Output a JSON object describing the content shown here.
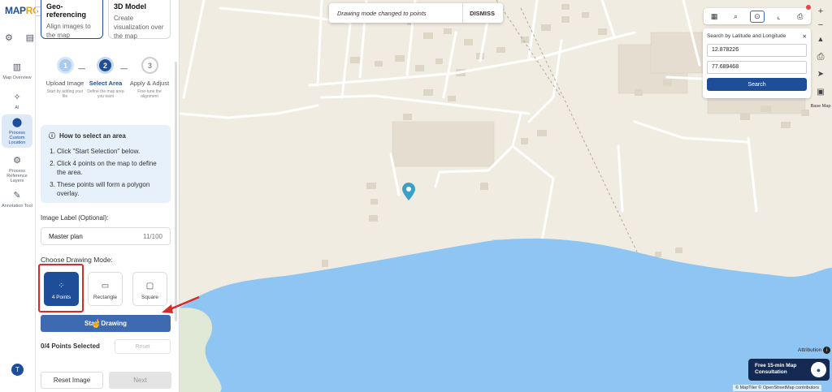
{
  "brand": {
    "left": "MAP",
    "right": "RO"
  },
  "rail": {
    "items": [
      {
        "label": "Map Overview"
      },
      {
        "label": "AI"
      },
      {
        "label": "Process Custom Location"
      },
      {
        "label": "Process Reference Layers"
      },
      {
        "label": "Annotation Tool"
      }
    ],
    "avatar": "T"
  },
  "cards": [
    {
      "title": "Geo-referencing",
      "desc": "Align images to the map"
    },
    {
      "title": "3D Model",
      "desc": "Create visualization over the map"
    }
  ],
  "steps": [
    {
      "num": "1",
      "label": "Upload Image",
      "sub": "Start by adding your file"
    },
    {
      "num": "2",
      "label": "Select Area",
      "sub": "Define the map area you want"
    },
    {
      "num": "3",
      "label": "Apply & Adjust",
      "sub": "Fine-tune the alignment"
    }
  ],
  "info": {
    "title": "How to select an area",
    "items": [
      "Click \"Start Selection\" below.",
      "Click 4 points on the map to define the area.",
      "These points will form a polygon overlay."
    ]
  },
  "image_label": {
    "label": "Image Label (Optional):",
    "value": "Master plan",
    "count": "11/100"
  },
  "drawing_mode": {
    "label": "Choose Drawing Mode:",
    "modes": [
      "4 Points",
      "Rectangle",
      "Square"
    ]
  },
  "start_drawing": "Start Drawing",
  "points_selected": "0/4 Points Selected",
  "reset_small": "Reset",
  "reset_image": "Reset Image",
  "next": "Next",
  "toast": {
    "message": "Drawing mode changed to points",
    "dismiss": "DISMISS"
  },
  "search": {
    "title": "Search by Latitude and Longitude",
    "lat": "12.878226",
    "lng": "77.689468",
    "button": "Search"
  },
  "basemap_label": "Base Map",
  "attribution": "Attribution",
  "consult": "Free 15-min Map Consultation",
  "osm": "© MapTiler © OpenStreetMap contributors",
  "colors": {
    "primary": "#1f4e99",
    "water": "#8ec5f3",
    "land": "#f1ece2",
    "highlight": "#d42b2b"
  }
}
